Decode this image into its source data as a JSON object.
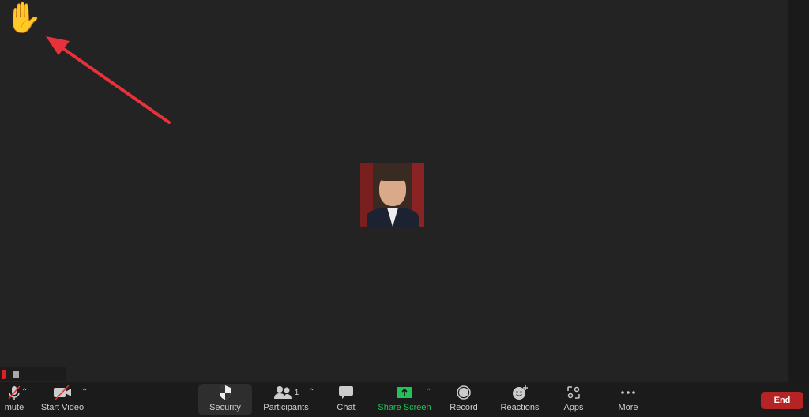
{
  "raised_hand": "✋",
  "toolbar": {
    "unmute": "mute",
    "start_video": "Start Video",
    "security": "Security",
    "participants": "Participants",
    "participants_count": "1",
    "chat": "Chat",
    "share_screen": "Share Screen",
    "record": "Record",
    "reactions": "Reactions",
    "apps": "Apps",
    "more": "More",
    "end": "End",
    "caret": "⌃"
  },
  "colors": {
    "accent_green": "#22c25a",
    "end_red": "#b52424",
    "annotation_arrow": "#e8313a"
  }
}
